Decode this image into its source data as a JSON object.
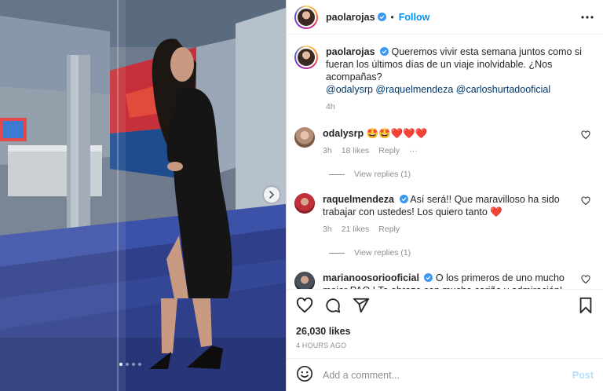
{
  "header": {
    "username": "paolarojas",
    "separator": "•",
    "follow_label": "Follow"
  },
  "caption": {
    "username": "paolarojas",
    "text": "Queremos vivir esta semana juntos como si fueran los últimos días de un viaje inolvidable. ¿Nos acompañas?",
    "mentions": [
      "@odalysrp",
      "@raquelmendeza",
      "@carloshurtadooficial"
    ],
    "time": "4h"
  },
  "comments": [
    {
      "username": "odalysrp",
      "verified": false,
      "text": "🤩🤩❤️❤️❤️",
      "time": "3h",
      "likes": "18 likes",
      "reply": "Reply",
      "more": "···",
      "view_replies": "View replies (1)"
    },
    {
      "username": "raquelmendeza",
      "verified": true,
      "text": "Así será!! Que maravilloso ha sido trabajar con ustedes! Los quiero tanto ❤️",
      "time": "3h",
      "likes": "21 likes",
      "reply": "Reply",
      "view_replies": "View replies (1)"
    },
    {
      "username": "marianoosoriooficial",
      "verified": true,
      "text": "O los primeros de uno mucho mejor PAO ! Te abrazo con mucho cariño y admiración!"
    }
  ],
  "actions": {
    "likes": "26,030 likes",
    "time_ago": "4 HOURS AGO"
  },
  "add_comment": {
    "placeholder": "Add a comment...",
    "post_label": "Post"
  },
  "carousel": {
    "total": 4,
    "active": 1
  },
  "colors": {
    "accent": "#0095f6",
    "verified": "#3897f0",
    "heart": "#ed4956"
  },
  "icons": [
    "more-icon",
    "heart-icon",
    "comment-icon",
    "share-icon",
    "bookmark-icon",
    "emoji-icon",
    "chevron-right-icon",
    "verified-icon"
  ]
}
